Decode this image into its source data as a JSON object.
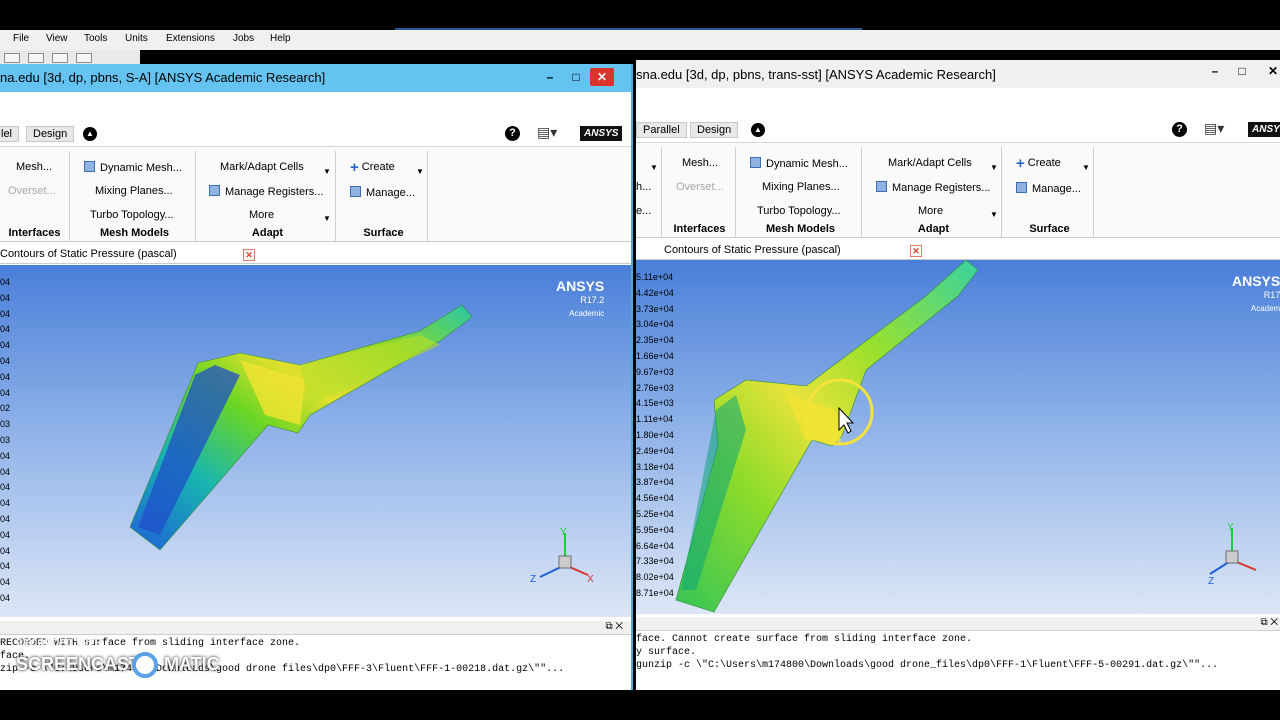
{
  "menu": {
    "file": "File",
    "view": "View",
    "tools": "Tools",
    "units": "Units",
    "extensions": "Extensions",
    "jobs": "Jobs",
    "help": "Help"
  },
  "left_window": {
    "title": "na.edu  [3d, dp, pbns, S-A] [ANSYS Academic Research]",
    "tabs": [
      "lel",
      "Design"
    ],
    "ribbon": {
      "interfaces": {
        "items": [
          "Mesh...",
          "Overset..."
        ],
        "label": "Interfaces"
      },
      "mesh_models": {
        "items": [
          "Dynamic Mesh...",
          "Mixing Planes...",
          "Turbo Topology..."
        ],
        "label": "Mesh Models"
      },
      "adapt": {
        "items": [
          "Mark/Adapt Cells",
          "Manage Registers...",
          "More"
        ],
        "label": "Adapt"
      },
      "surface": {
        "items": [
          "Create",
          "Manage..."
        ],
        "label": "Surface"
      }
    },
    "view_tab": "Contours of Static Pressure (pascal)",
    "ansys_logo": {
      "name": "ANSYS",
      "version": "R17.2",
      "edition": "Academic"
    },
    "legend_suffixes": [
      "04",
      "04",
      "04",
      "04",
      "04",
      "04",
      "04",
      "04",
      "02",
      "03",
      "03",
      "04",
      "04",
      "04",
      "04",
      "04",
      "04",
      "04",
      "04",
      "04",
      "04"
    ],
    "console": [
      "RECORDED WITH surface from sliding interface zone.",
      "face.",
      "zip -c \\\"C:\\Users\\m174800\\Downloads\\good drone files\\dp0\\FFF-3\\Fluent\\FFF-1-00218.dat.gz\\\"\"..."
    ]
  },
  "right_window": {
    "title": "sna.edu  [3d, dp, pbns, trans-sst] [ANSYS Academic Research]",
    "tabs": [
      "Parallel",
      "Design"
    ],
    "ribbon": {
      "left_items": [
        "h...",
        "e..."
      ],
      "interfaces": {
        "items": [
          "Mesh...",
          "Overset..."
        ],
        "label": "Interfaces"
      },
      "mesh_models": {
        "items": [
          "Dynamic Mesh...",
          "Mixing Planes...",
          "Turbo Topology..."
        ],
        "label": "Mesh Models"
      },
      "adapt": {
        "items": [
          "Mark/Adapt Cells",
          "Manage Registers...",
          "More"
        ],
        "label": "Adapt"
      },
      "surface": {
        "items": [
          "Create",
          "Manage..."
        ],
        "label": "Surface"
      }
    },
    "view_tab": "Contours of Static Pressure (pascal)",
    "ansys_logo": {
      "name": "ANSYS",
      "version": "R17",
      "edition": "Academ"
    },
    "legend": [
      "5.11e+04",
      "4.42e+04",
      "3.73e+04",
      "3.04e+04",
      "2.35e+04",
      "1.66e+04",
      "9.67e+03",
      "2.76e+03",
      "4.15e+03",
      "1.11e+04",
      "1.80e+04",
      "2.49e+04",
      "3.18e+04",
      "3.87e+04",
      "4.56e+04",
      "5.25e+04",
      "5.95e+04",
      "6.64e+04",
      "7.33e+04",
      "8.02e+04",
      "8.71e+04"
    ],
    "console": [
      "face. Cannot create surface from sliding interface zone.",
      "y surface.",
      "gunzip -c \\\"C:\\Users\\m174800\\Downloads\\good drone_files\\dp0\\FFF-1\\Fluent\\FFF-5-00291.dat.gz\\\"\"..."
    ]
  },
  "watermark": {
    "line1": "RECORDED WITH",
    "line2": "SCREENCAST",
    "line3": "MATIC"
  },
  "logo_text": "ANSYS",
  "colors": {
    "title_active": "#64c3f0",
    "close": "#d9342b",
    "view_top": "#4a7fd9",
    "view_bottom": "#dce6f6"
  }
}
